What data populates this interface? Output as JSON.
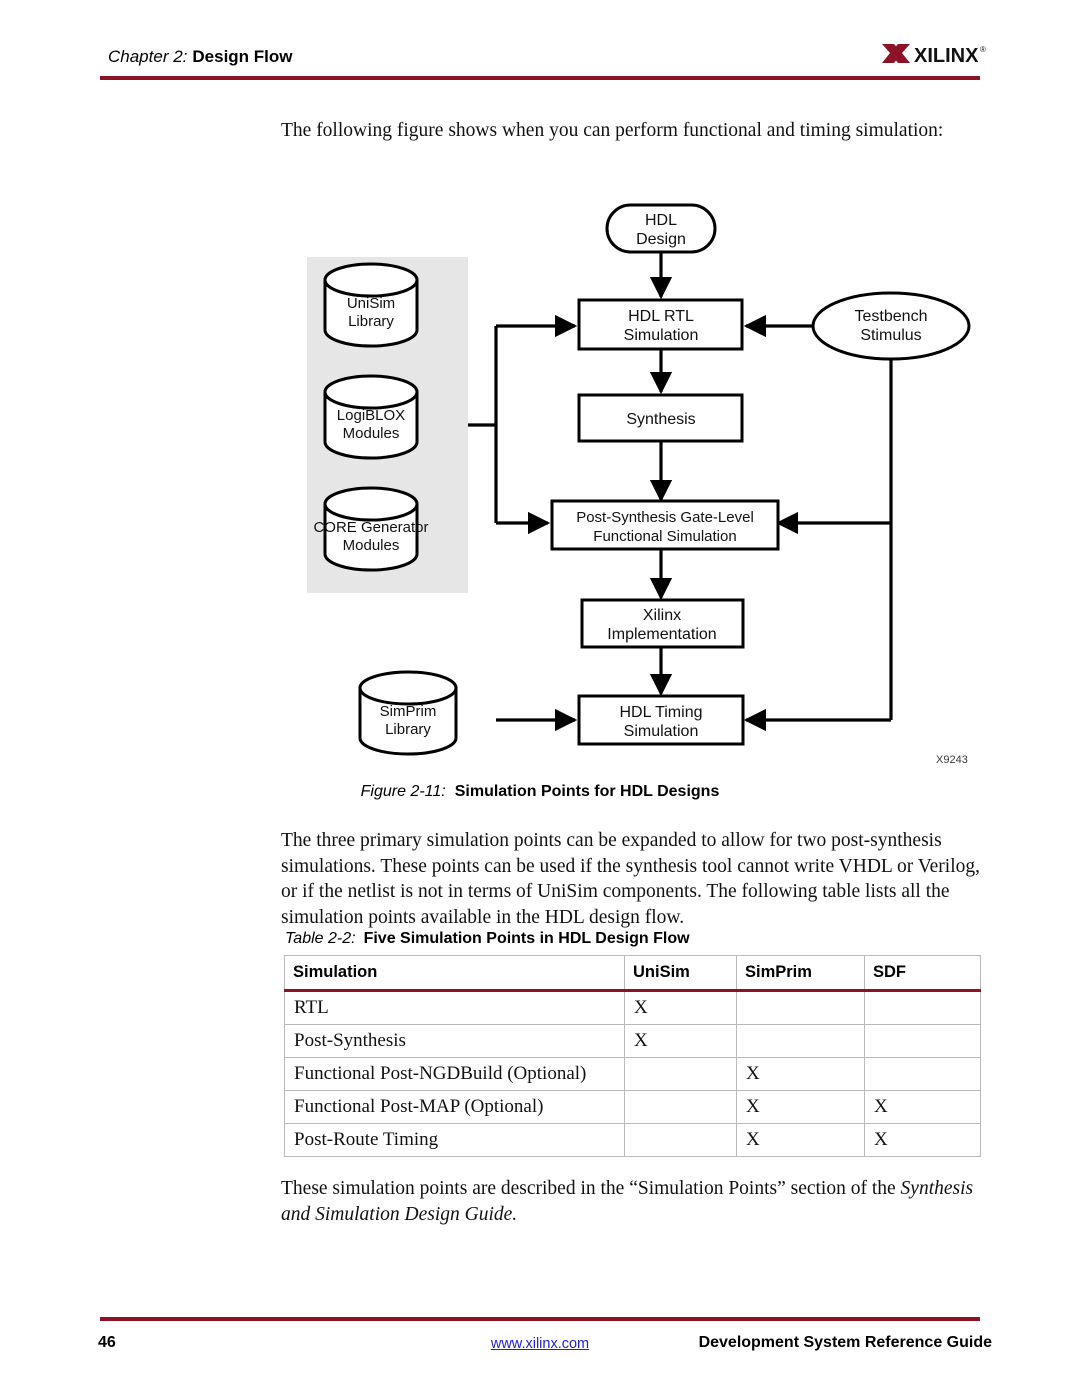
{
  "header": {
    "chapter_label": "Chapter 2:",
    "chapter_title": "Design Flow",
    "logo_text": "XILINX",
    "logo_registered": "®",
    "rule_color": "#8c1326"
  },
  "intro_paragraph": "The following figure shows when you can perform functional and timing simulation:",
  "figure": {
    "caption_number": "Figure 2-11:",
    "caption_text": "Simulation Points for HDL Designs",
    "artwork_id": "X9243",
    "nodes": {
      "hdl_design": "HDL\nDesign",
      "hdl_design_line1": "HDL",
      "hdl_design_line2": "Design",
      "hdl_rtl_line1": "HDL RTL",
      "hdl_rtl_line2": "Simulation",
      "testbench_line1": "Testbench",
      "testbench_line2": "Stimulus",
      "synthesis": "Synthesis",
      "post_synth_line1": "Post-Synthesis Gate-Level",
      "post_synth_line2": "Functional Simulation",
      "xilinx_impl_line1": "Xilinx",
      "xilinx_impl_line2": "Implementation",
      "hdl_timing_line1": "HDL Timing",
      "hdl_timing_line2": "Simulation",
      "unisim_line1": "UniSim",
      "unisim_line2": "Library",
      "logiblox_line1": "LogiBLOX",
      "logiblox_line2": "Modules",
      "coregen_line1": "CORE Generator",
      "coregen_line2": "Modules",
      "simprim_line1": "SimPrim",
      "simprim_line2": "Library"
    }
  },
  "mid_paragraph": {
    "text": "The three primary simulation points can be expanded to allow for two post-synthesis simulations. These points can be used if the synthesis tool cannot write VHDL or Verilog, or if the netlist is not in terms of UniSim components. The following table lists all the simulation points available in the HDL design flow."
  },
  "table": {
    "caption_number": "Table 2-2:",
    "caption_text": "Five Simulation Points in HDL Design Flow",
    "header_rule_color": "#8c1326",
    "columns": [
      "Simulation",
      "UniSim",
      "SimPrim",
      "SDF"
    ],
    "rows": [
      {
        "simulation": "RTL",
        "unisim": "X",
        "simprim": "",
        "sdf": ""
      },
      {
        "simulation": "Post-Synthesis",
        "unisim": "X",
        "simprim": "",
        "sdf": ""
      },
      {
        "simulation": "Functional Post-NGDBuild (Optional)",
        "unisim": "",
        "simprim": "X",
        "sdf": ""
      },
      {
        "simulation": "Functional Post-MAP (Optional)",
        "unisim": "",
        "simprim": "X",
        "sdf": "X"
      },
      {
        "simulation": "Post-Route Timing",
        "unisim": "",
        "simprim": "X",
        "sdf": "X"
      }
    ]
  },
  "end_paragraph": {
    "lead": "These simulation points are described in the “Simulation Points” section of the ",
    "italic": "Synthesis and Simulation Design Guide",
    "trail": "."
  },
  "footer": {
    "page_number": "46",
    "link_text": "www.xilinx.com",
    "guide_title": "Development System Reference Guide",
    "link_color": "#2222cc",
    "rule_color": "#8c1326"
  }
}
